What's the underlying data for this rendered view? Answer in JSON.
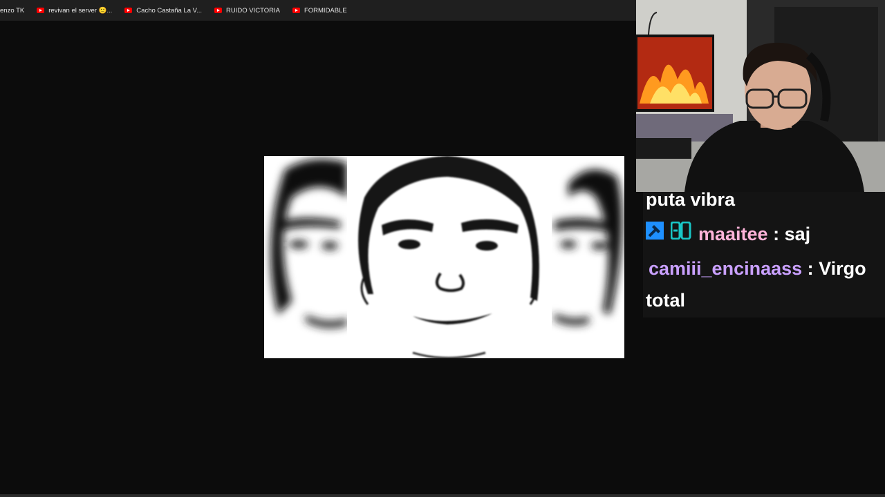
{
  "bookmarks": [
    {
      "label": "enzo TK",
      "icon": "none"
    },
    {
      "label": "revivan el server 🙂...",
      "icon": "youtube-icon"
    },
    {
      "label": "Cacho Castaña La V...",
      "icon": "youtube-icon"
    },
    {
      "label": "RUIDO VICTORIA",
      "icon": "youtube-icon"
    },
    {
      "label": "FORMIDABLE",
      "icon": "youtube-icon"
    }
  ],
  "chat": {
    "messages": [
      {
        "user": "",
        "separator": "",
        "text": "puta vibra"
      },
      {
        "user": "maaitee",
        "separator": " : ",
        "text": "saj",
        "user_color": "#ffb3d9",
        "badges": [
          "hammer-icon",
          "badge-icon"
        ]
      },
      {
        "user": "camiii_encinaass",
        "separator": " : ",
        "text": "Virgo",
        "user_color": "#c9a0ff"
      },
      {
        "user": "",
        "separator": "",
        "text": "total"
      }
    ]
  },
  "colors": {
    "background": "#0c0c0c",
    "bookmarks_bar": "#1f1f1f",
    "youtube_red": "#ff0000"
  }
}
